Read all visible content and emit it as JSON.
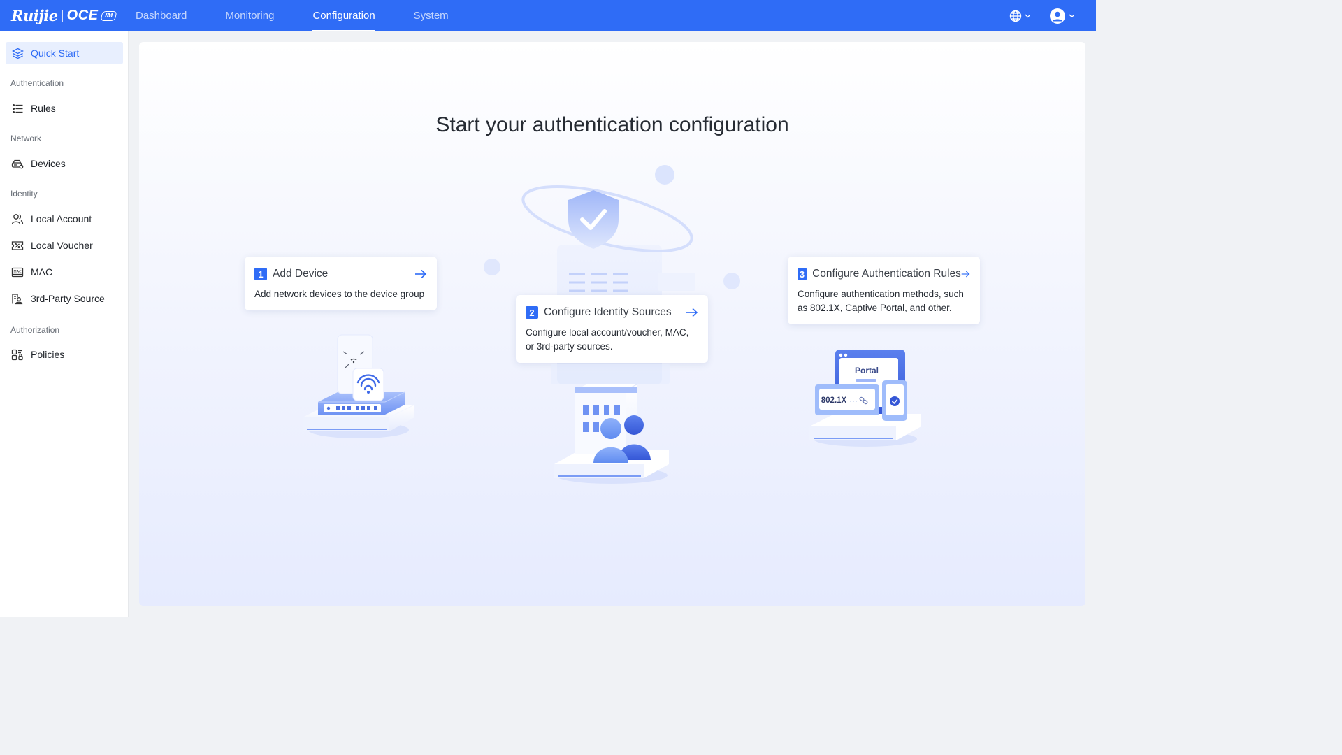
{
  "brand": {
    "name": "Ruijie",
    "product": "OCE",
    "badge": "IM"
  },
  "nav": {
    "items": [
      {
        "label": "Dashboard"
      },
      {
        "label": "Monitoring"
      },
      {
        "label": "Configuration",
        "active": true
      },
      {
        "label": "System"
      }
    ]
  },
  "topbar": {
    "language_icon": "globe-icon",
    "user_icon": "user-avatar-icon",
    "color": "#2f6cf6"
  },
  "sidebar": {
    "quick_start": "Quick Start",
    "groups": {
      "authentication": "Authentication",
      "network": "Network",
      "identity": "Identity",
      "authorization": "Authorization"
    },
    "items": {
      "rules": "Rules",
      "devices": "Devices",
      "local_account": "Local Account",
      "local_voucher": "Local Voucher",
      "mac": "MAC",
      "third_party": "3rd-Party Source",
      "policies": "Policies"
    }
  },
  "main": {
    "title": "Start your authentication configuration",
    "cards": [
      {
        "step": "1",
        "title": "Add Device",
        "desc": "Add network devices to the device group"
      },
      {
        "step": "2",
        "title": "Configure Identity Sources",
        "desc": "Configure local account/voucher, MAC, or 3rd-party sources."
      },
      {
        "step": "3",
        "title": "Configure Authentication Rules",
        "desc": "Configure authentication methods, such as 802.1X, Captive Portal, and other."
      }
    ],
    "illustration_text": {
      "portal": "Portal",
      "dot1x": "802.1X"
    }
  }
}
